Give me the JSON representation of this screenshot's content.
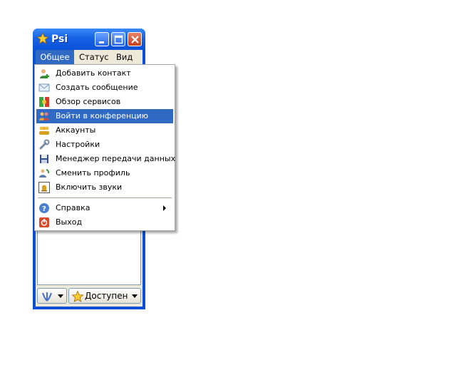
{
  "window": {
    "title": "Psi",
    "menubar": [
      "Общее",
      "Статус",
      "Вид"
    ]
  },
  "menu": {
    "items": [
      {
        "label": "Добавить контакт",
        "icon": "add-contact-icon"
      },
      {
        "label": "Создать сообщение",
        "icon": "envelope-icon"
      },
      {
        "label": "Обзор сервисов",
        "icon": "service-discovery-icon"
      },
      {
        "label": "Войти в конференцию",
        "icon": "conference-icon",
        "highlighted": true
      },
      {
        "label": "Аккаунты",
        "icon": "accounts-icon"
      },
      {
        "label": "Настройки",
        "icon": "wrench-icon"
      },
      {
        "label": "Менеджер передачи данных",
        "icon": "floppy-icon"
      },
      {
        "label": "Сменить профиль",
        "icon": "change-profile-icon"
      },
      {
        "label": "Включить звуки",
        "icon": "bell-icon"
      }
    ],
    "items2": [
      {
        "label": "Справка",
        "icon": "help-icon",
        "submenu": true
      },
      {
        "label": "Выход",
        "icon": "power-icon"
      }
    ]
  },
  "status": {
    "current": "Доступен"
  },
  "colors": {
    "titlebar": "#0a52d8",
    "highlight": "#316ac5",
    "close_button": "#c6401b"
  }
}
